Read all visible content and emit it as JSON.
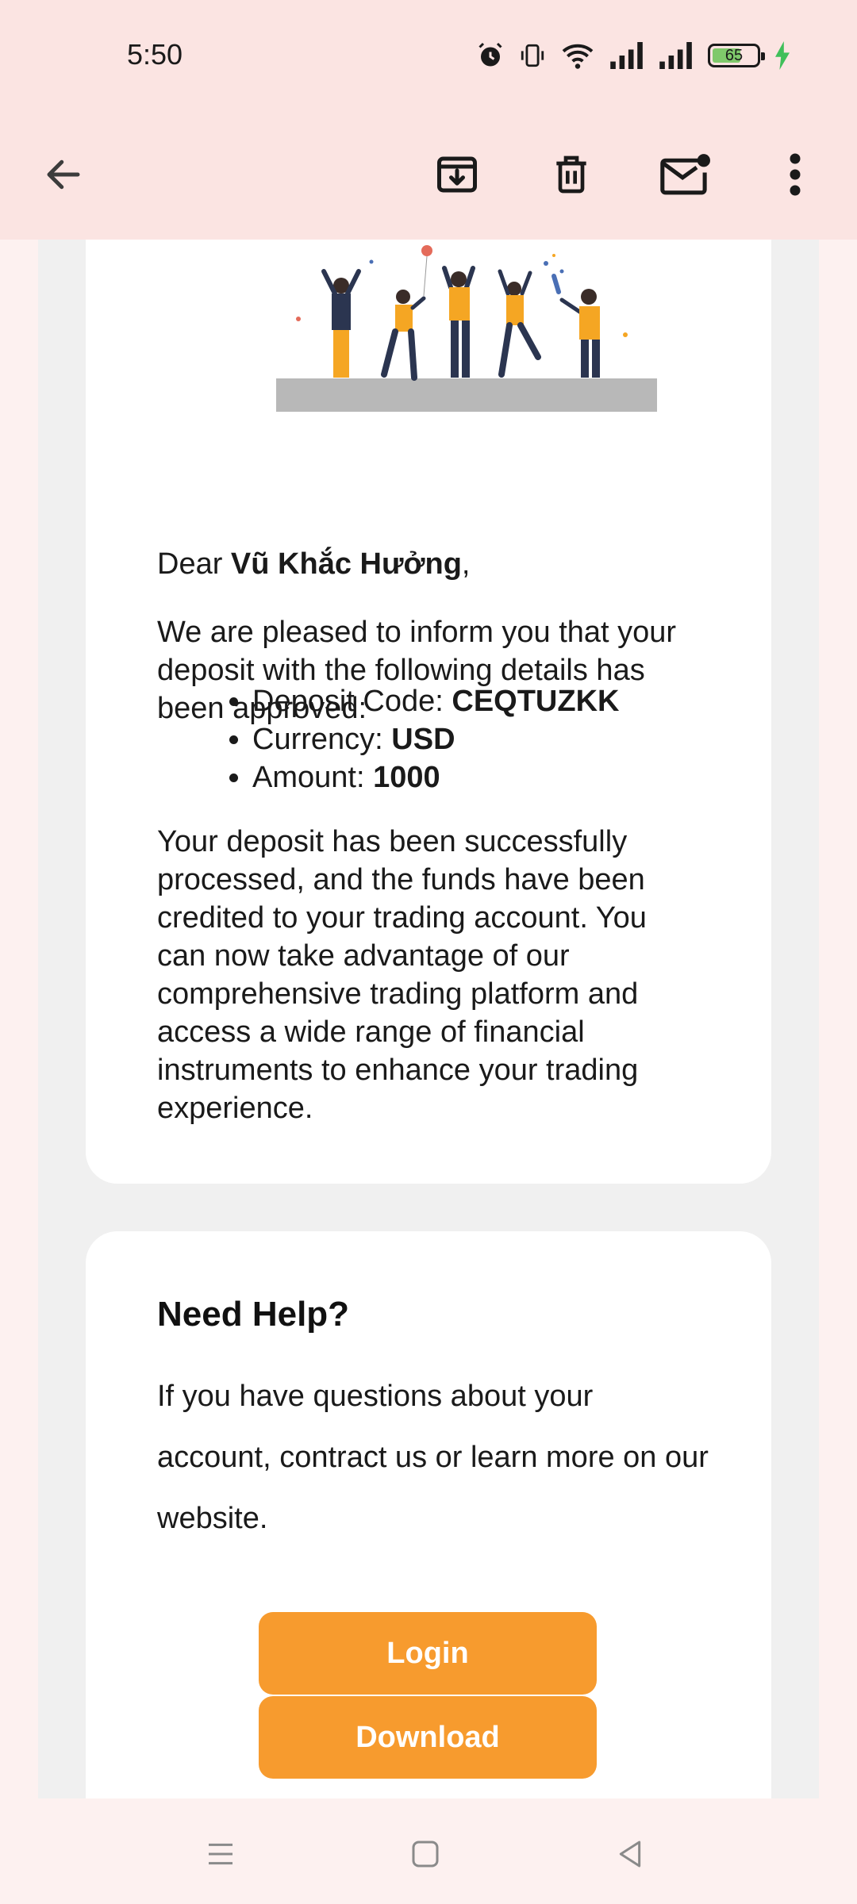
{
  "status": {
    "time": "5:50",
    "battery": "65",
    "battery_level": 0.65,
    "battery_color": "#7fc96b"
  },
  "toolbar": {
    "back_icon": "arrow-left-icon",
    "archive_icon": "archive-icon",
    "delete_icon": "trash-icon",
    "unread_icon": "mail-unread-icon",
    "more_icon": "more-vert-icon"
  },
  "email": {
    "greeting_prefix": "Dear ",
    "recipient_name": "Vũ Khắc Hưởng",
    "greeting_suffix": ",",
    "intro": "We are pleased to inform you that your deposit with the following details has been approved:",
    "details": [
      {
        "label": "Deposit Code: ",
        "value": "CEQTUZKK"
      },
      {
        "label": "Currency: ",
        "value": "USD"
      },
      {
        "label": "Amount: ",
        "value": "1000"
      }
    ],
    "body": "Your deposit has been successfully processed, and the funds have been credited to your trading account. You can now take advantage of our comprehensive trading platform and access a wide range of financial instruments to enhance your trading experience."
  },
  "help": {
    "title": "Need Help?",
    "text": "If you have questions about your account, contract us or learn more on our website.",
    "login_label": "Login",
    "download_label": "Download"
  },
  "colors": {
    "accent": "#f79b2e",
    "header_bg": "#fbe4e2"
  },
  "nav": {
    "recents_icon": "menu-lines-icon",
    "home_icon": "square-home-icon",
    "back_icon": "triangle-back-icon"
  }
}
